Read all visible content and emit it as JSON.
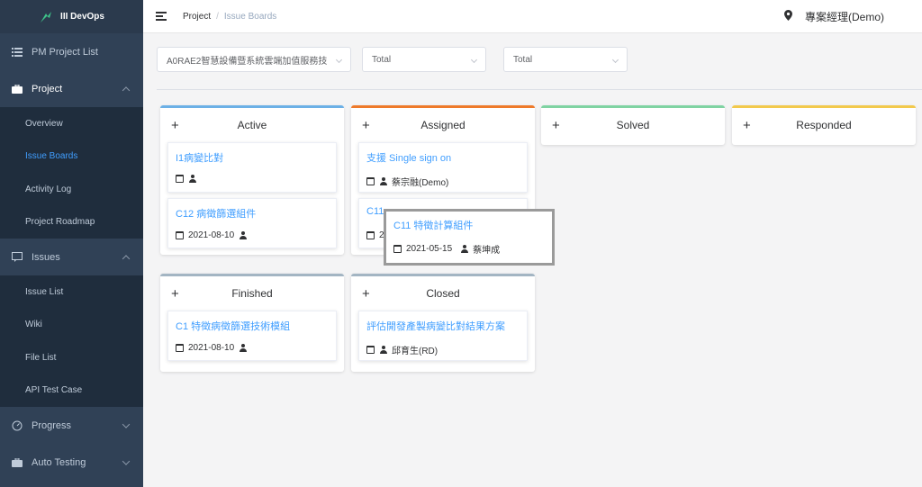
{
  "app": {
    "name": "III DevOps"
  },
  "colors": {
    "sidebar_bg": "#304156",
    "sidebar_active": "#409eff",
    "link": "#409eff",
    "active": "#6cb0e6",
    "assigned": "#ee7a2a",
    "solved": "#7fd3a2",
    "responded": "#f2c94c",
    "finished": "#a3b5c3",
    "closed": "#a3b5c3"
  },
  "sidebar": {
    "pm_project_list": "PM Project List",
    "project": "Project",
    "project_sub": [
      "Overview",
      "Issue Boards",
      "Activity Log",
      "Project Roadmap"
    ],
    "issues": "Issues",
    "issues_sub": [
      "Issue List",
      "Wiki",
      "File List",
      "API Test Case"
    ],
    "progress": "Progress",
    "auto_testing": "Auto Testing"
  },
  "header": {
    "breadcrumb_root": "Project",
    "breadcrumb_sep": "/",
    "breadcrumb_current": "Issue Boards",
    "user": "專案經理(Demo)"
  },
  "filters": {
    "project": "A0RAE2智慧設備暨系統雲端加值服務技",
    "filter2": "Total",
    "filter3": "Total"
  },
  "board": {
    "plus": "+",
    "columns": {
      "active": {
        "title": "Active",
        "cards": [
          {
            "title": "I1病變比對",
            "date": "",
            "assignee": ""
          },
          {
            "title": "C12 病徵篩選組件",
            "date": "2021-08-10",
            "assignee": ""
          }
        ]
      },
      "assigned": {
        "title": "Assigned",
        "cards": [
          {
            "title": "支援 Single sign on",
            "date": "",
            "assignee": "蔡宗融(Demo)"
          },
          {
            "title": "C11",
            "date": "2",
            "assignee": ""
          }
        ]
      },
      "solved": {
        "title": "Solved"
      },
      "responded": {
        "title": "Responded"
      },
      "finished": {
        "title": "Finished",
        "cards": [
          {
            "title": "C1 特徵病徵篩選技術模組",
            "date": "2021-08-10",
            "assignee": ""
          }
        ]
      },
      "closed": {
        "title": "Closed",
        "cards": [
          {
            "title": "評估開發產製病變比對結果方案",
            "date": "",
            "assignee": "邱育生(RD)"
          }
        ]
      }
    },
    "dragging": {
      "title": "C11 特徵計算組件",
      "date": "2021-05-15",
      "assignee": "蔡坤成"
    }
  }
}
